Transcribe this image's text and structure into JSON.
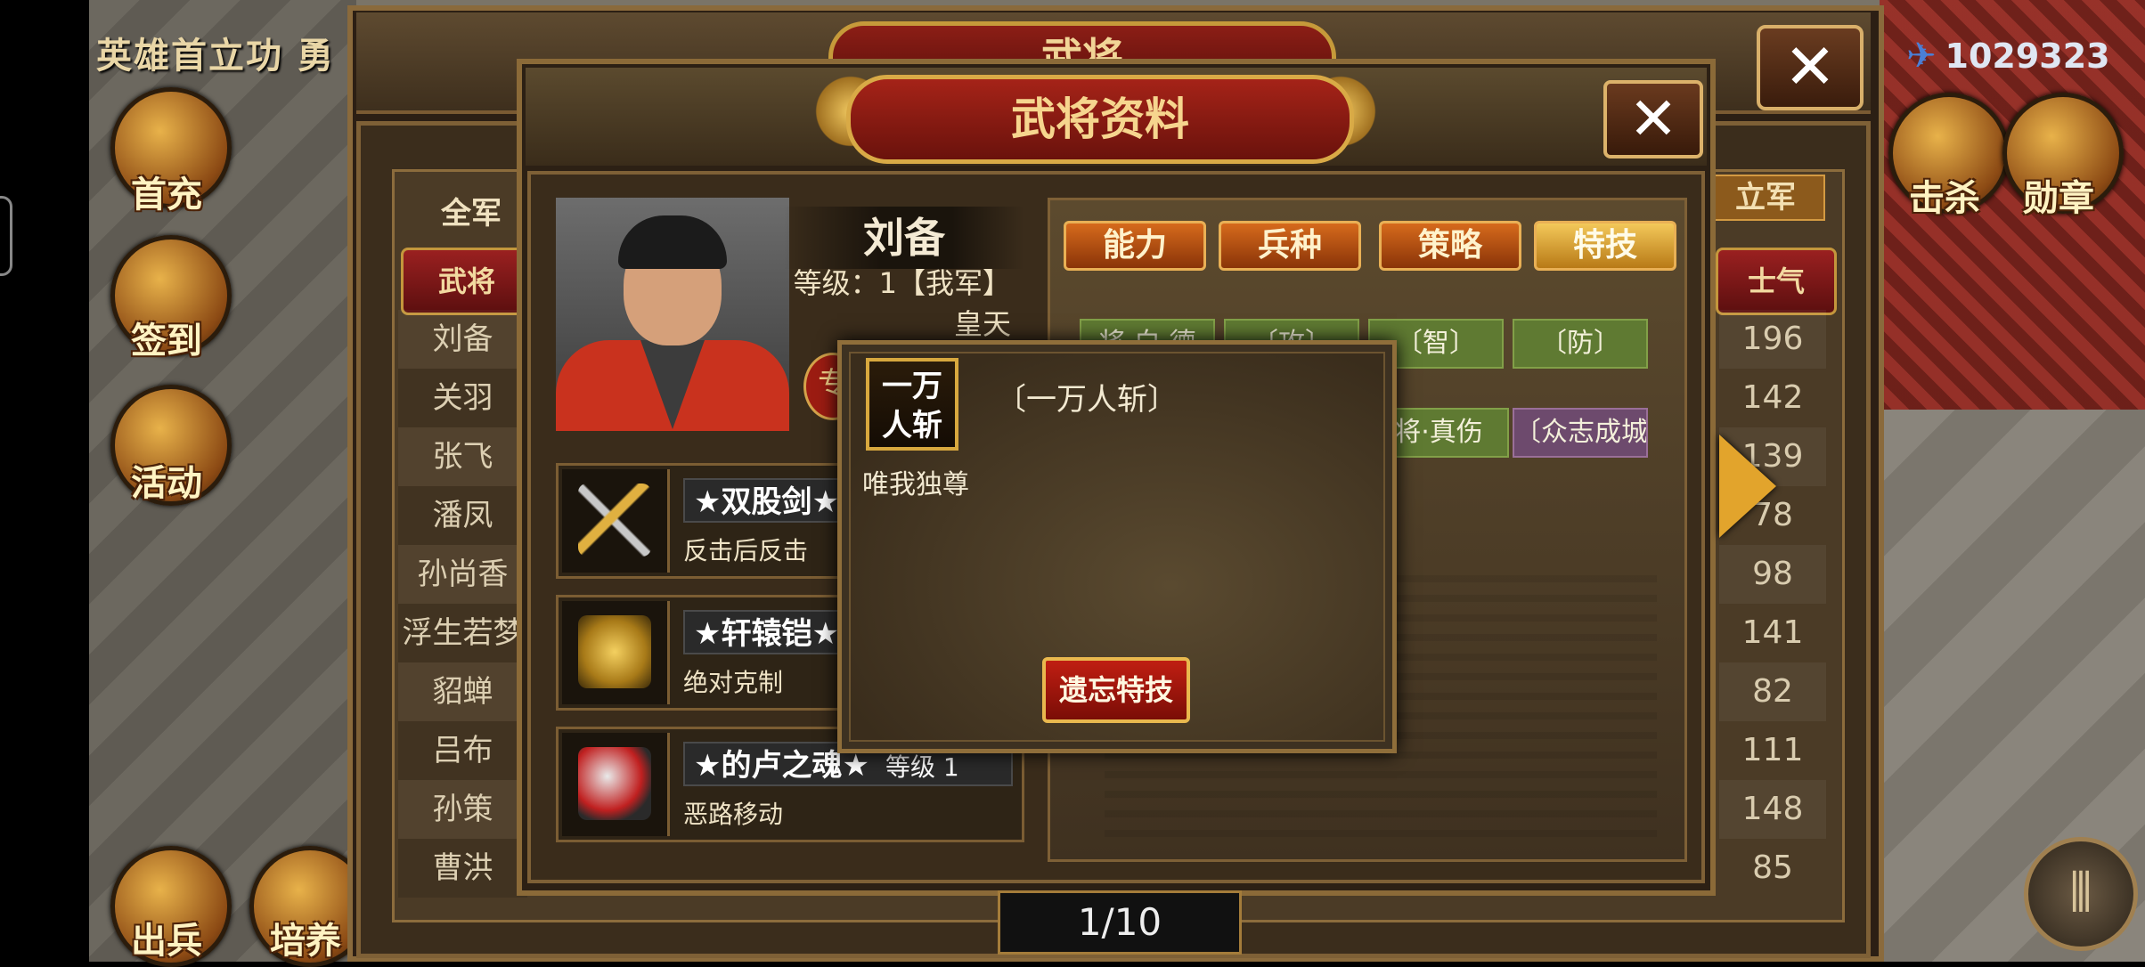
{
  "event_banner": "英雄首立功 勇",
  "currency": {
    "icon": "wing-icon",
    "value": "1029323"
  },
  "left_menu": [
    {
      "label": "首充",
      "icon": "gift-icon"
    },
    {
      "label": "签到",
      "icon": "calendar-icon"
    },
    {
      "label": "活动",
      "icon": "chest-icon"
    }
  ],
  "bottom_left_menu": [
    {
      "label": "出兵",
      "icon": "flag-icon"
    },
    {
      "label": "培养",
      "icon": "cauldron-icon"
    }
  ],
  "right_menu": [
    {
      "label": "击杀",
      "icon": "crossed-swords-icon"
    },
    {
      "label": "勋章",
      "icon": "medal-icon"
    }
  ],
  "back_panel": {
    "title": "武将",
    "all_army": "全军",
    "right_tab": "立军",
    "col_general": "武将",
    "col_morale": "士气",
    "generals": [
      "刘备",
      "关羽",
      "张飞",
      "潘凤",
      "孙尚香",
      "浮生若梦",
      "貂蝉",
      "吕布",
      "孙策",
      "曹洪"
    ],
    "morale": [
      "196",
      "142",
      "139",
      "78",
      "98",
      "141",
      "82",
      "111",
      "148",
      "85"
    ],
    "page": "1/10"
  },
  "dialog": {
    "title": "武将资料",
    "name": "刘备",
    "level": "等级：1【我军】",
    "subtitle": "皇天",
    "badge": "专",
    "tabs": [
      "能力",
      "兵种",
      "策略",
      "特技"
    ],
    "active_tab": "特技",
    "chips_row1": [
      "将·白·德",
      "〔攻〕",
      "〔智〕",
      "〔防〕"
    ],
    "chips_row2": [
      "将·真伤",
      "〔众志成城〕"
    ],
    "equipment": [
      {
        "name": "★双股剑★",
        "level": "",
        "desc": "反击后反击",
        "icon": "twin-sword-icon"
      },
      {
        "name": "★轩辕铠★",
        "level": "",
        "desc": "绝对克制",
        "icon": "armor-icon"
      },
      {
        "name": "★的卢之魂★",
        "level": "等级 1",
        "desc": "恶路移动",
        "icon": "horse-icon"
      }
    ]
  },
  "popup": {
    "icon_text": "一万人斩",
    "icon_line1": "一万",
    "icon_line2": "人斩",
    "title": "〔一万人斩〕",
    "desc": "唯我独尊",
    "forget_button": "遗忘特技"
  },
  "colors": {
    "accent_gold": "#e9b055",
    "title_red": "#a52318",
    "chip_green": "#5f7a32",
    "chip_purple": "#6d4a6d"
  }
}
